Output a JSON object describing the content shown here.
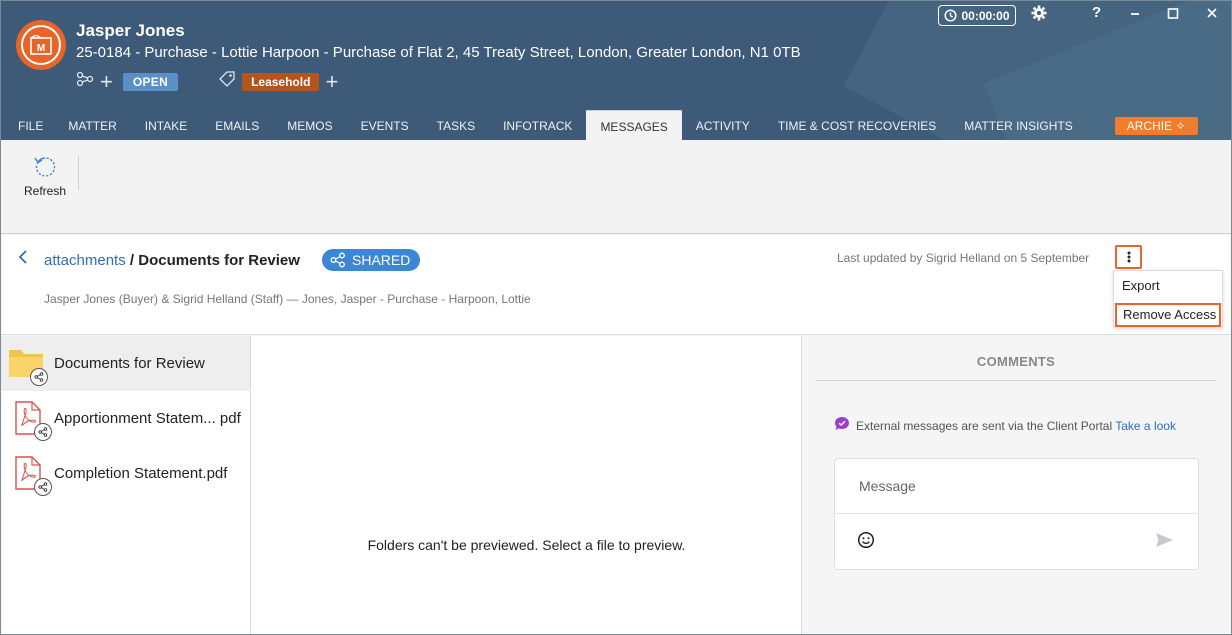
{
  "header": {
    "client_name": "Jasper Jones",
    "matter_desc": "25-0184 - Purchase - Lottie Harpoon - Purchase of Flat 2, 45 Treaty Street, London, Greater London, N1 0TB",
    "status_badge": "OPEN",
    "tag_badge": "Leasehold",
    "timer": "00:00:00",
    "help": "?",
    "minimize": "✕",
    "restore": "☐",
    "close": "✕"
  },
  "tabs": [
    {
      "label": "FILE"
    },
    {
      "label": "MATTER"
    },
    {
      "label": "INTAKE"
    },
    {
      "label": "EMAILS"
    },
    {
      "label": "MEMOS"
    },
    {
      "label": "EVENTS"
    },
    {
      "label": "TASKS"
    },
    {
      "label": "INFOTRACK"
    },
    {
      "label": "MESSAGES",
      "active": true
    },
    {
      "label": "ACTIVITY"
    },
    {
      "label": "TIME & COST RECOVERIES"
    },
    {
      "label": "MATTER INSIGHTS"
    },
    {
      "label": "ARCHIE"
    }
  ],
  "ribbon": {
    "refresh_label": "Refresh"
  },
  "infobar": {
    "crumb_link": "attachments",
    "crumb_sep": " / ",
    "crumb_current": "Documents for Review",
    "shared_label": "SHARED",
    "participants": "Jasper Jones (Buyer) & Sigrid Helland (Staff) — Jones, Jasper - Purchase - Harpoon, Lottie",
    "last_updated": "Last updated by Sigrid Helland on 5 September"
  },
  "menu": {
    "export": "Export",
    "remove_access": "Remove Access"
  },
  "files": [
    {
      "name": "Documents for Review",
      "type": "folder",
      "selected": true
    },
    {
      "name": "Apportionment Statem... pdf",
      "type": "pdf"
    },
    {
      "name": "Completion Statement.pdf",
      "type": "pdf"
    }
  ],
  "preview": {
    "message": "Folders can't be previewed. Select a file to preview."
  },
  "comments": {
    "title": "COMMENTS",
    "note": "External messages are sent via the Client Portal",
    "note_link": "Take a look",
    "message_placeholder": "Message"
  },
  "colors": {
    "accent": "#e8652a",
    "header_bg": "#3d5a78",
    "link": "#2f6fb5",
    "shared": "#3b87d6"
  }
}
